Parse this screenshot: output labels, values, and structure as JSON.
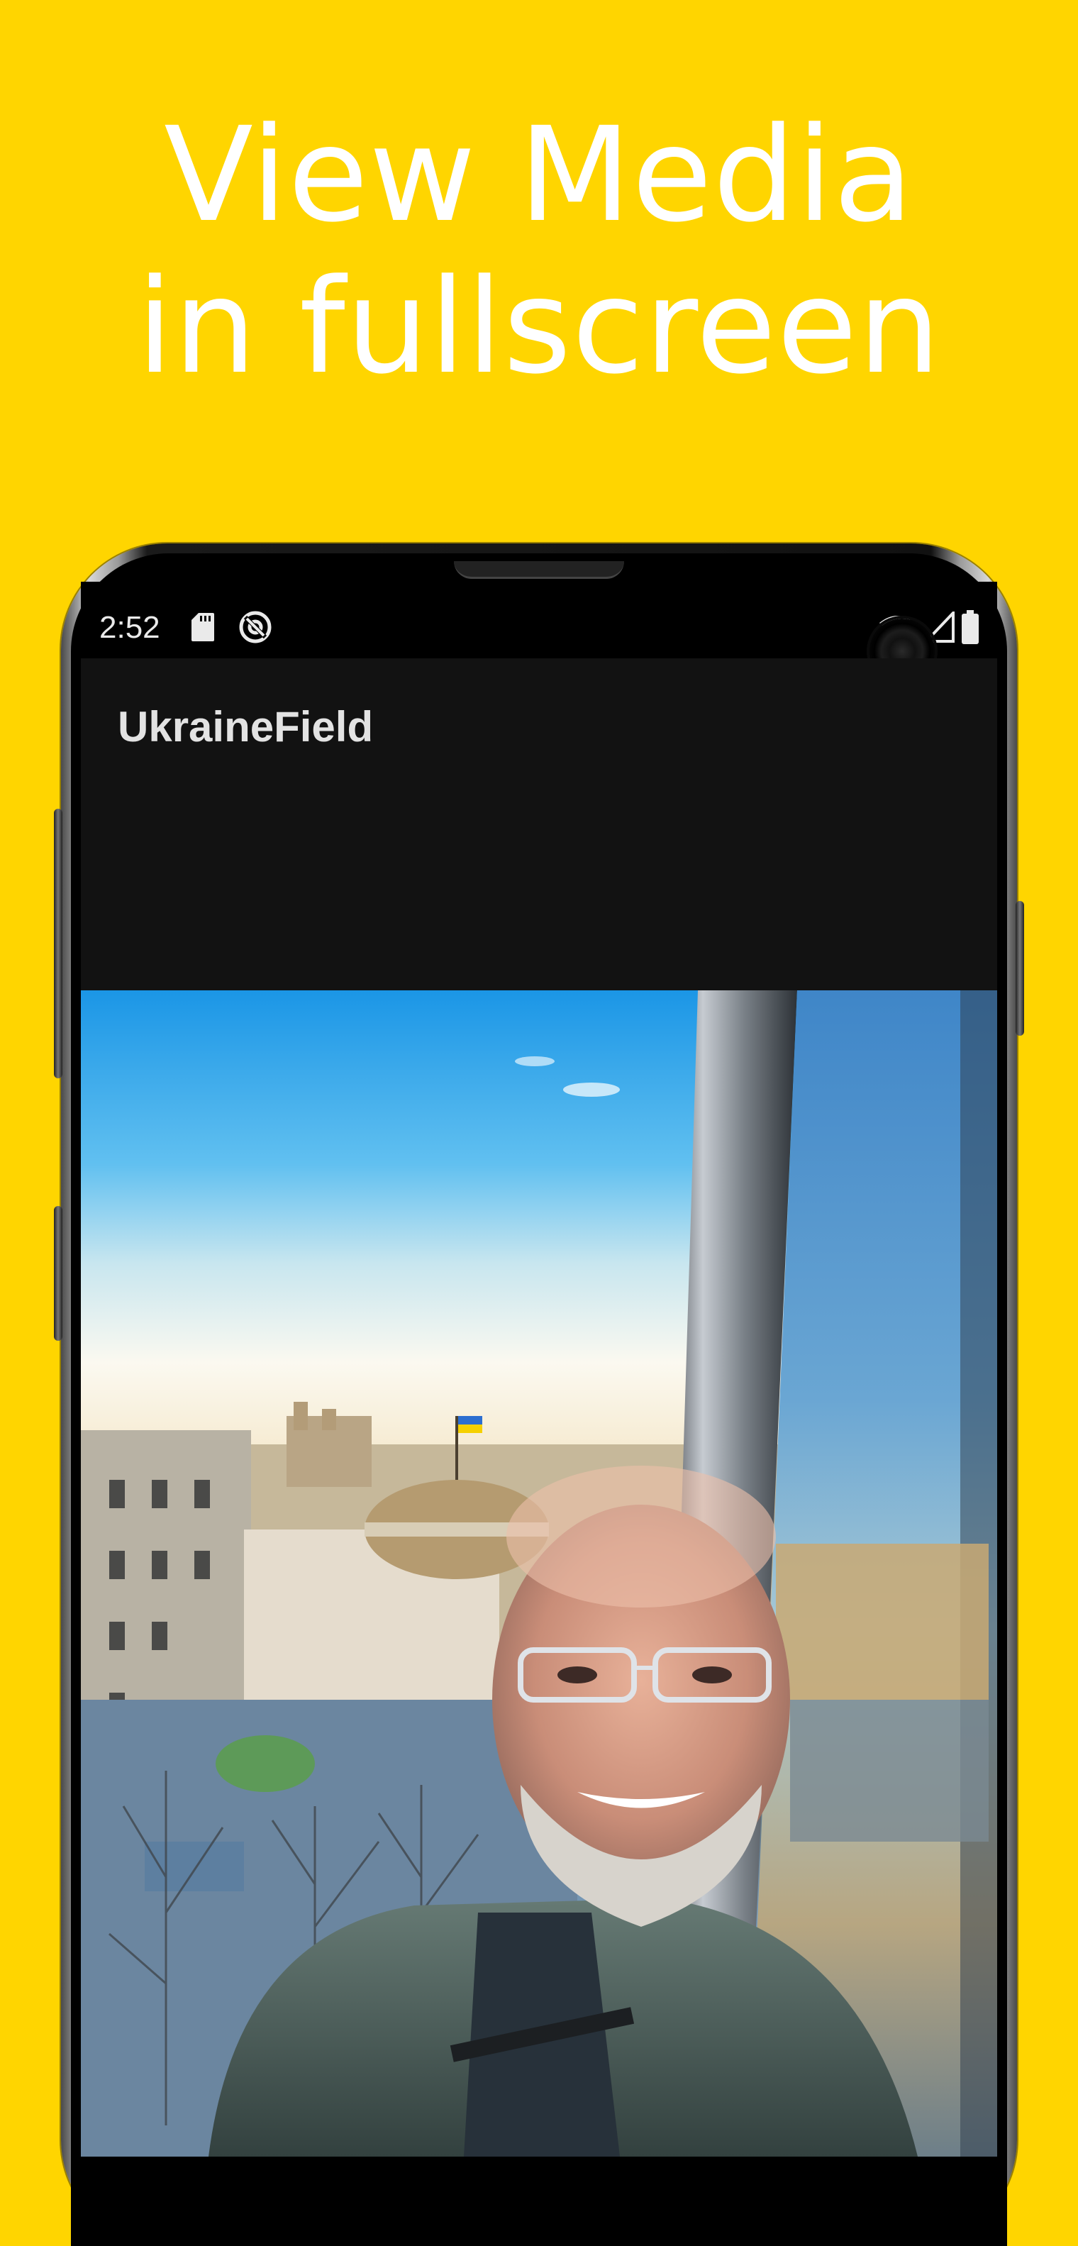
{
  "promo": {
    "headline_line1": "View Media",
    "headline_line2": "in fullscreen"
  },
  "status_bar": {
    "time": "2:52",
    "icons": [
      "sd-card-icon",
      "sync-icon",
      "wifi-icon",
      "cell-signal-icon",
      "battery-icon"
    ]
  },
  "app_bar": {
    "title": "UkraineField"
  },
  "media": {
    "description_icon": "fullscreen-photo"
  },
  "colors": {
    "background": "#FFD500",
    "headline": "#FFFFFF",
    "app_bar": "#121212",
    "status_bar": "#000000"
  }
}
